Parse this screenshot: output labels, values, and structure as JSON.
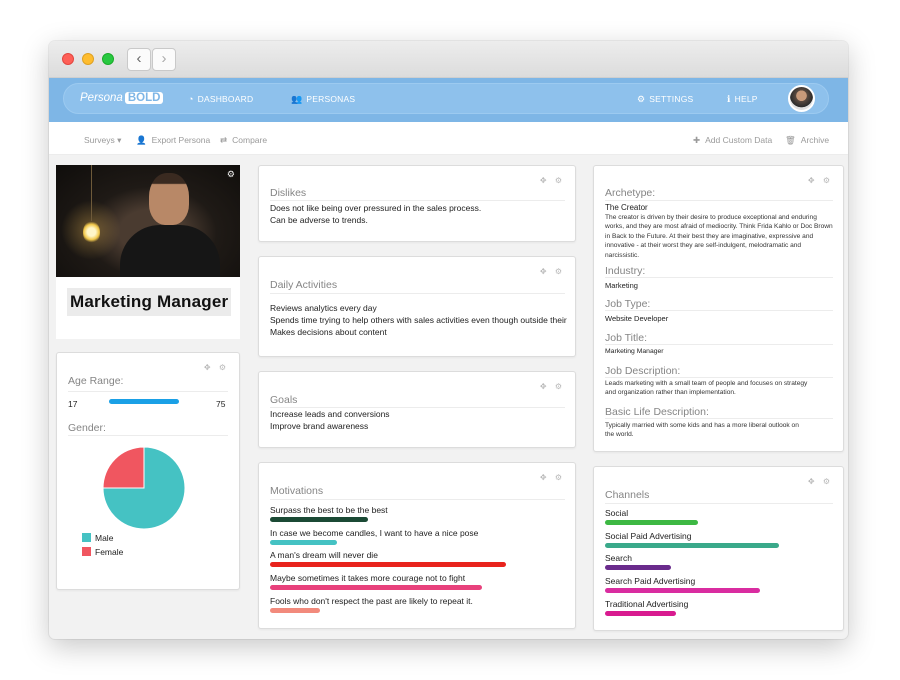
{
  "browser": {
    "back_glyph": "‹",
    "forward_glyph": "›"
  },
  "header": {
    "logo_regular": "Persona",
    "logo_bold": "BOLD",
    "nav": [
      {
        "icon": "tachometer-icon",
        "glyph": "◔",
        "label": "DASHBOARD"
      },
      {
        "icon": "users-icon",
        "glyph": "👥",
        "label": "PERSONAS"
      },
      {
        "icon": "gear-icon",
        "glyph": "⚙",
        "label": "SETTINGS"
      },
      {
        "icon": "info-icon",
        "glyph": "ℹ",
        "label": "HELP"
      }
    ]
  },
  "toolbar": {
    "surveys": "Surveys ▾",
    "export": "Export Persona",
    "compare": "Compare",
    "add_custom": "Add Custom Data",
    "archive": "Archive",
    "icons": {
      "export": "👤",
      "compare": "⇄",
      "add": "✚",
      "archive": "🗑"
    }
  },
  "profile": {
    "title": "Marketing Manager",
    "gear": "⚙"
  },
  "card_tools": "✥ ⚙",
  "demographics": {
    "age_label": "Age Range:",
    "age_min": "17",
    "age_max": "75",
    "gender_label": "Gender:",
    "gender": [
      {
        "name": "Male",
        "value": 75,
        "color": "#45c2c3"
      },
      {
        "name": "Female",
        "value": 25,
        "color": "#f05660"
      }
    ],
    "age_bar_color": "#1aa0e6"
  },
  "dislikes": {
    "title": "Dislikes",
    "lines": [
      "Does not like being over pressured in the sales process.",
      "Can be adverse to trends."
    ]
  },
  "daily": {
    "title": "Daily Activities",
    "lines": [
      "Reviews analytics every day",
      "Spends time trying to help others with sales activities even though outside their",
      "Makes decisions about content"
    ]
  },
  "goals": {
    "title": "Goals",
    "lines": [
      "Increase leads and conversions",
      "Improve brand awareness"
    ]
  },
  "motivations": {
    "title": "Motivations",
    "items": [
      {
        "label": "Surpass the best to be the best",
        "value": 0.41,
        "color": "#1b4a35"
      },
      {
        "label": "In case we become candles, I want to have a nice pose",
        "value": 0.28,
        "color": "#45c2c3"
      },
      {
        "label": "A man's dream will never die",
        "value": 0.99,
        "color": "#e8231d"
      },
      {
        "label": "Maybe sometimes it takes more courage not to fight",
        "value": 0.89,
        "color": "#e8417c"
      },
      {
        "label": "Fools who don't respect the past are likely to repeat it.",
        "value": 0.21,
        "color": "#f28a7c"
      }
    ]
  },
  "profile_info": {
    "archetype_label": "Archetype:",
    "archetype_name": "The Creator",
    "archetype_desc": "The creator is driven by their desire to produce exceptional and enduring works, and they are most afraid of mediocrity. Think Frida Kahlo or Doc Brown in Back to the Future. At their best they are imaginative, expressive and innovative - at their worst they are self-indulgent, melodramatic and narcissistic.",
    "industry_label": "Industry:",
    "industry": "Marketing",
    "job_type_label": "Job Type:",
    "job_type": "Website Developer",
    "job_title_label": "Job Title:",
    "job_title": "Marketing Manager",
    "job_desc_label": "Job Description:",
    "job_desc": "Leads marketing with a small team of people and focuses on strategy and organization rather than implementation.",
    "life_label": "Basic Life Description:",
    "life_desc": "Typically married with some kids and has a more liberal outlook on the world."
  },
  "channels": {
    "title": "Channels",
    "items": [
      {
        "label": "Social",
        "value": 0.52,
        "color": "#3db843"
      },
      {
        "label": "Social Paid Advertising",
        "value": 0.98,
        "color": "#3aa98a"
      },
      {
        "label": "Search",
        "value": 0.37,
        "color": "#6a2b8c"
      },
      {
        "label": "Search Paid Advertising",
        "value": 0.87,
        "color": "#d92ca0"
      },
      {
        "label": "Traditional Advertising",
        "value": 0.4,
        "color": "#d81b8f"
      }
    ]
  }
}
